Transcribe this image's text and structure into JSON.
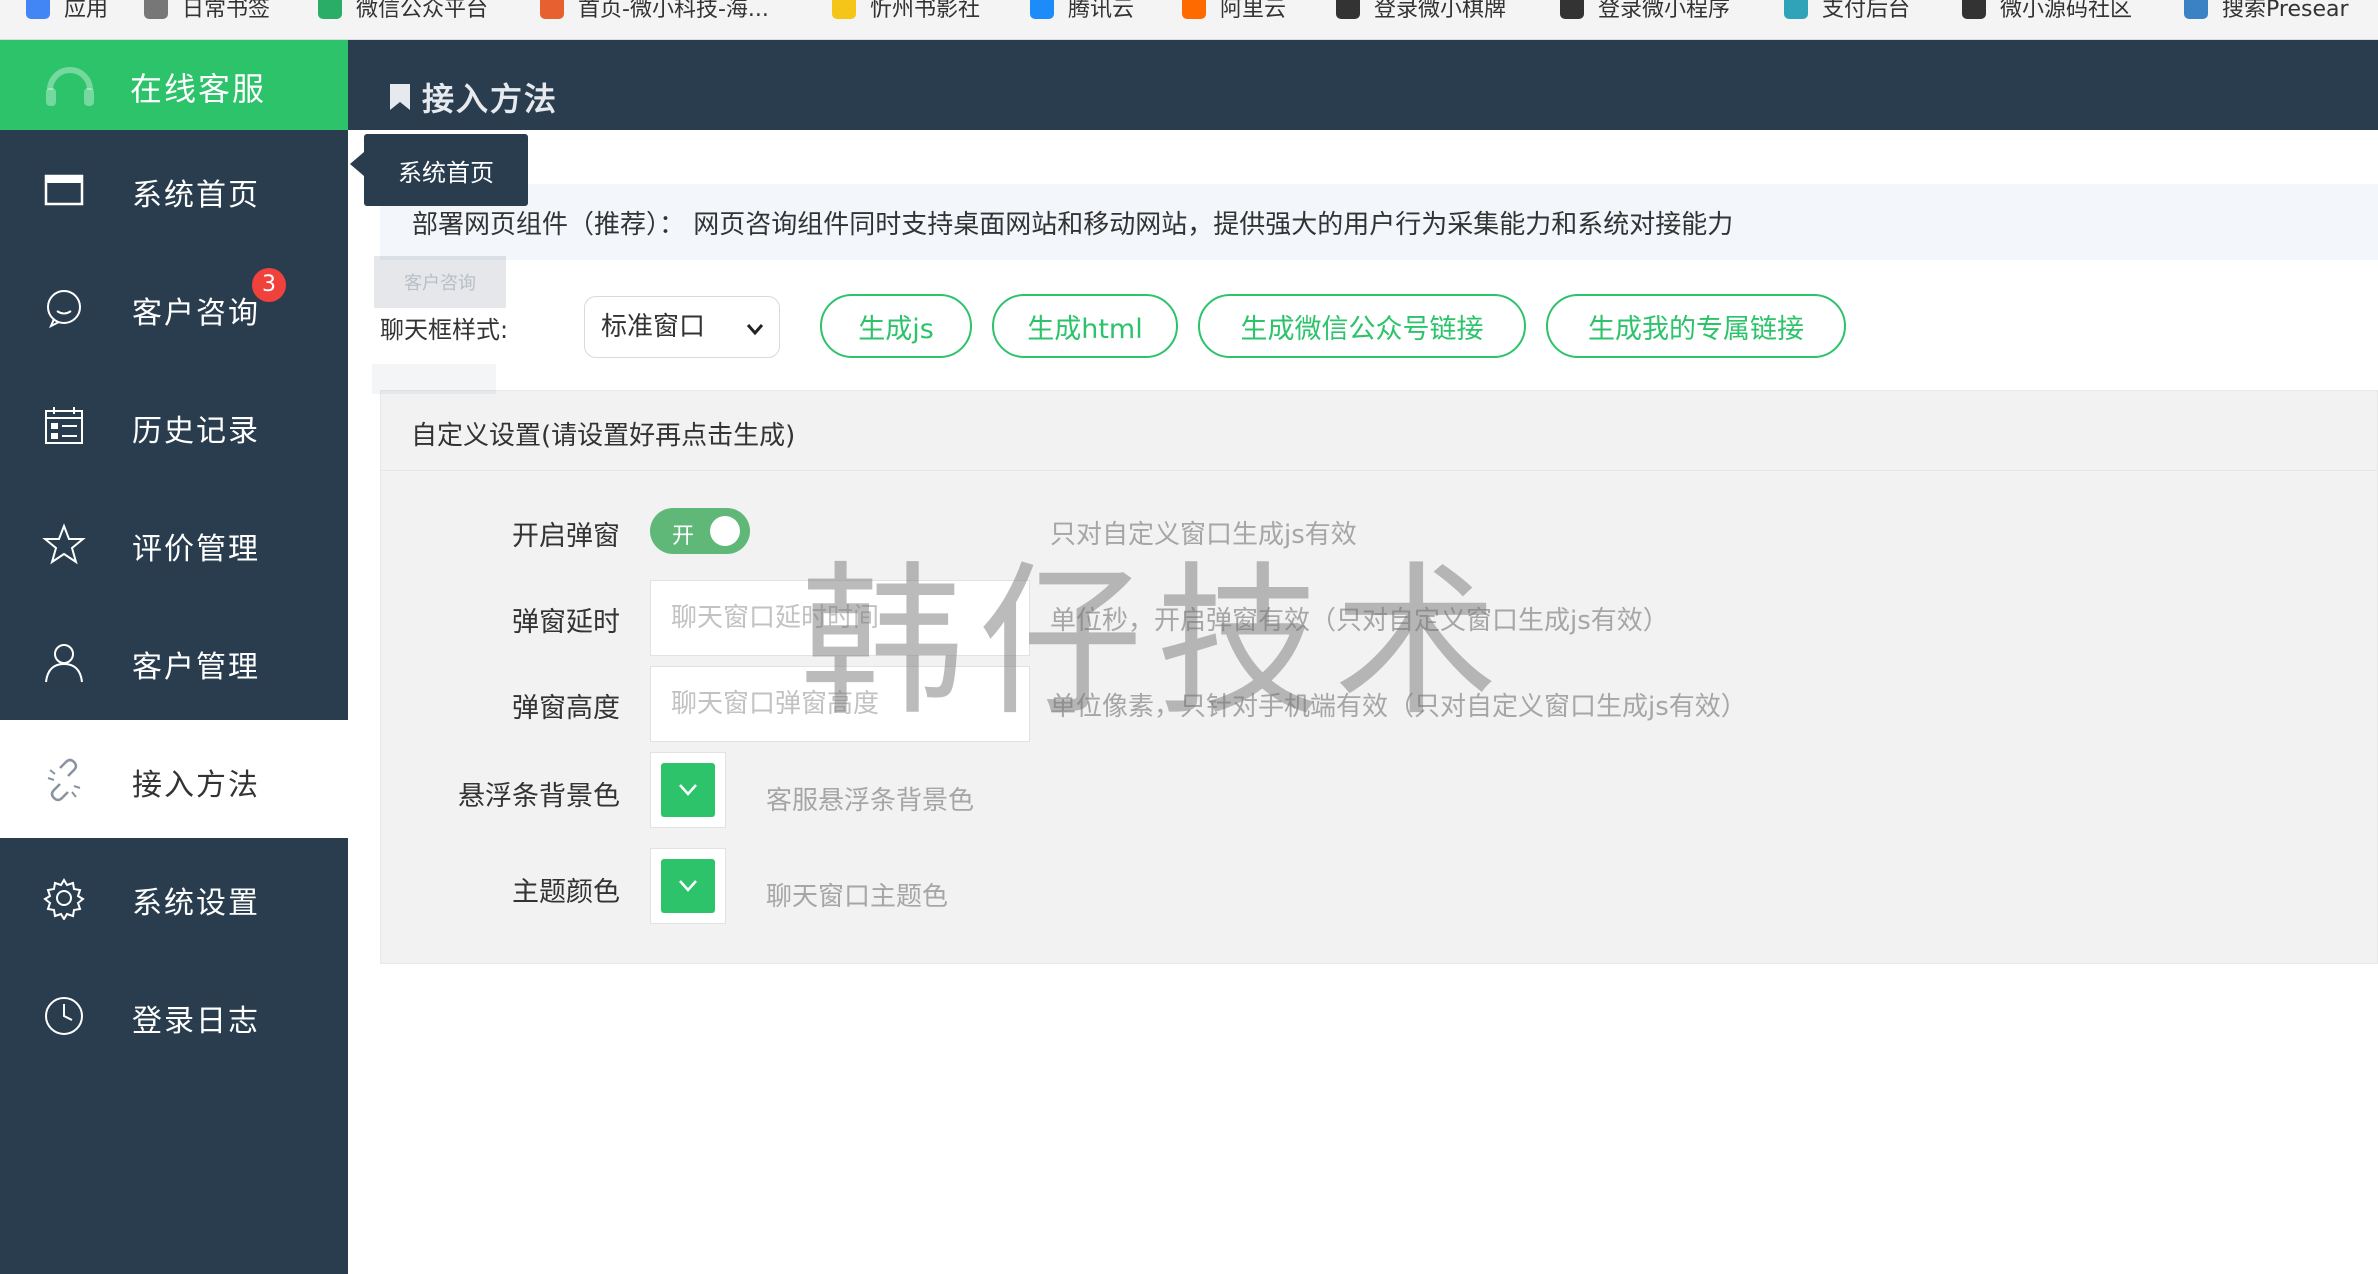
{
  "bookmarks": [
    {
      "label": "应用",
      "icon": "apps-grid-icon",
      "color": "#4285f4"
    },
    {
      "label": "日常书签",
      "icon": "folder-icon",
      "color": "#777777"
    },
    {
      "label": "微信公众平台",
      "icon": "wechat-icon",
      "color": "#2aae67"
    },
    {
      "label": "首页-微小科技-海...",
      "icon": "weibo-icon",
      "color": "#e6612f"
    },
    {
      "label": "忻州书影社",
      "icon": "emoji-icon",
      "color": "#f5c518"
    },
    {
      "label": "腾讯云",
      "icon": "cloud-icon",
      "color": "#1d8cf8"
    },
    {
      "label": "阿里云",
      "icon": "aliyun-icon",
      "color": "#ff6a00"
    },
    {
      "label": "登录微小棋牌",
      "icon": "site-icon",
      "color": "#333333"
    },
    {
      "label": "登录微小程序",
      "icon": "site-icon",
      "color": "#333333"
    },
    {
      "label": "支付后台",
      "icon": "shield-icon",
      "color": "#2fa4b8"
    },
    {
      "label": "微小源码社区",
      "icon": "site-icon",
      "color": "#333333"
    },
    {
      "label": "搜索Presear",
      "icon": "search-site-icon",
      "color": "#3b82c4"
    }
  ],
  "sidebar": {
    "brand": "在线客服",
    "brand_color": "#2cc36b",
    "bg_color": "#2a3d4f",
    "items": [
      {
        "label": "系统首页",
        "icon": "window-icon"
      },
      {
        "label": "客户咨询",
        "icon": "chat-bubble-icon",
        "badge": "3"
      },
      {
        "label": "历史记录",
        "icon": "calendar-list-icon"
      },
      {
        "label": "评价管理",
        "icon": "star-icon"
      },
      {
        "label": "客户管理",
        "icon": "user-icon"
      },
      {
        "label": "接入方法",
        "icon": "link-icon",
        "active": true
      },
      {
        "label": "系统设置",
        "icon": "gear-icon"
      },
      {
        "label": "登录日志",
        "icon": "clock-icon"
      }
    ]
  },
  "tooltip": {
    "text": "系统首页",
    "ghost_text": "客户咨询"
  },
  "header": {
    "title": "接入方法"
  },
  "content": {
    "intro": "部署网页组件（推荐）： 网页咨询组件同时支持桌面网站和移动网站，提供强大的用户行为采集能力和系统对接能力",
    "style_label": "聊天框样式:",
    "style_value": "标准窗口",
    "buttons": [
      "生成js",
      "生成html",
      "生成微信公众号链接",
      "生成我的专属链接"
    ],
    "panel_title": "自定义设置(请设置好再点击生成)",
    "popup": {
      "label": "开启弹窗",
      "switch_text": "开",
      "hint": "只对自定义窗口生成js有效"
    },
    "delay": {
      "label": "弹窗延时",
      "placeholder": "聊天窗口延时时间",
      "hint": "单位秒，开启弹窗有效（只对自定义窗口生成js有效）"
    },
    "height": {
      "label": "弹窗高度",
      "placeholder": "聊天窗口弹窗高度",
      "hint": "单位像素，只针对手机端有效（只对自定义窗口生成js有效）"
    },
    "float_bg": {
      "label": "悬浮条背景色",
      "hint": "客服悬浮条背景色",
      "color": "#2cc36b"
    },
    "theme": {
      "label": "主题颜色",
      "hint": "聊天窗口主题色",
      "color": "#2cc36b"
    }
  },
  "watermark": "韩仔技术"
}
